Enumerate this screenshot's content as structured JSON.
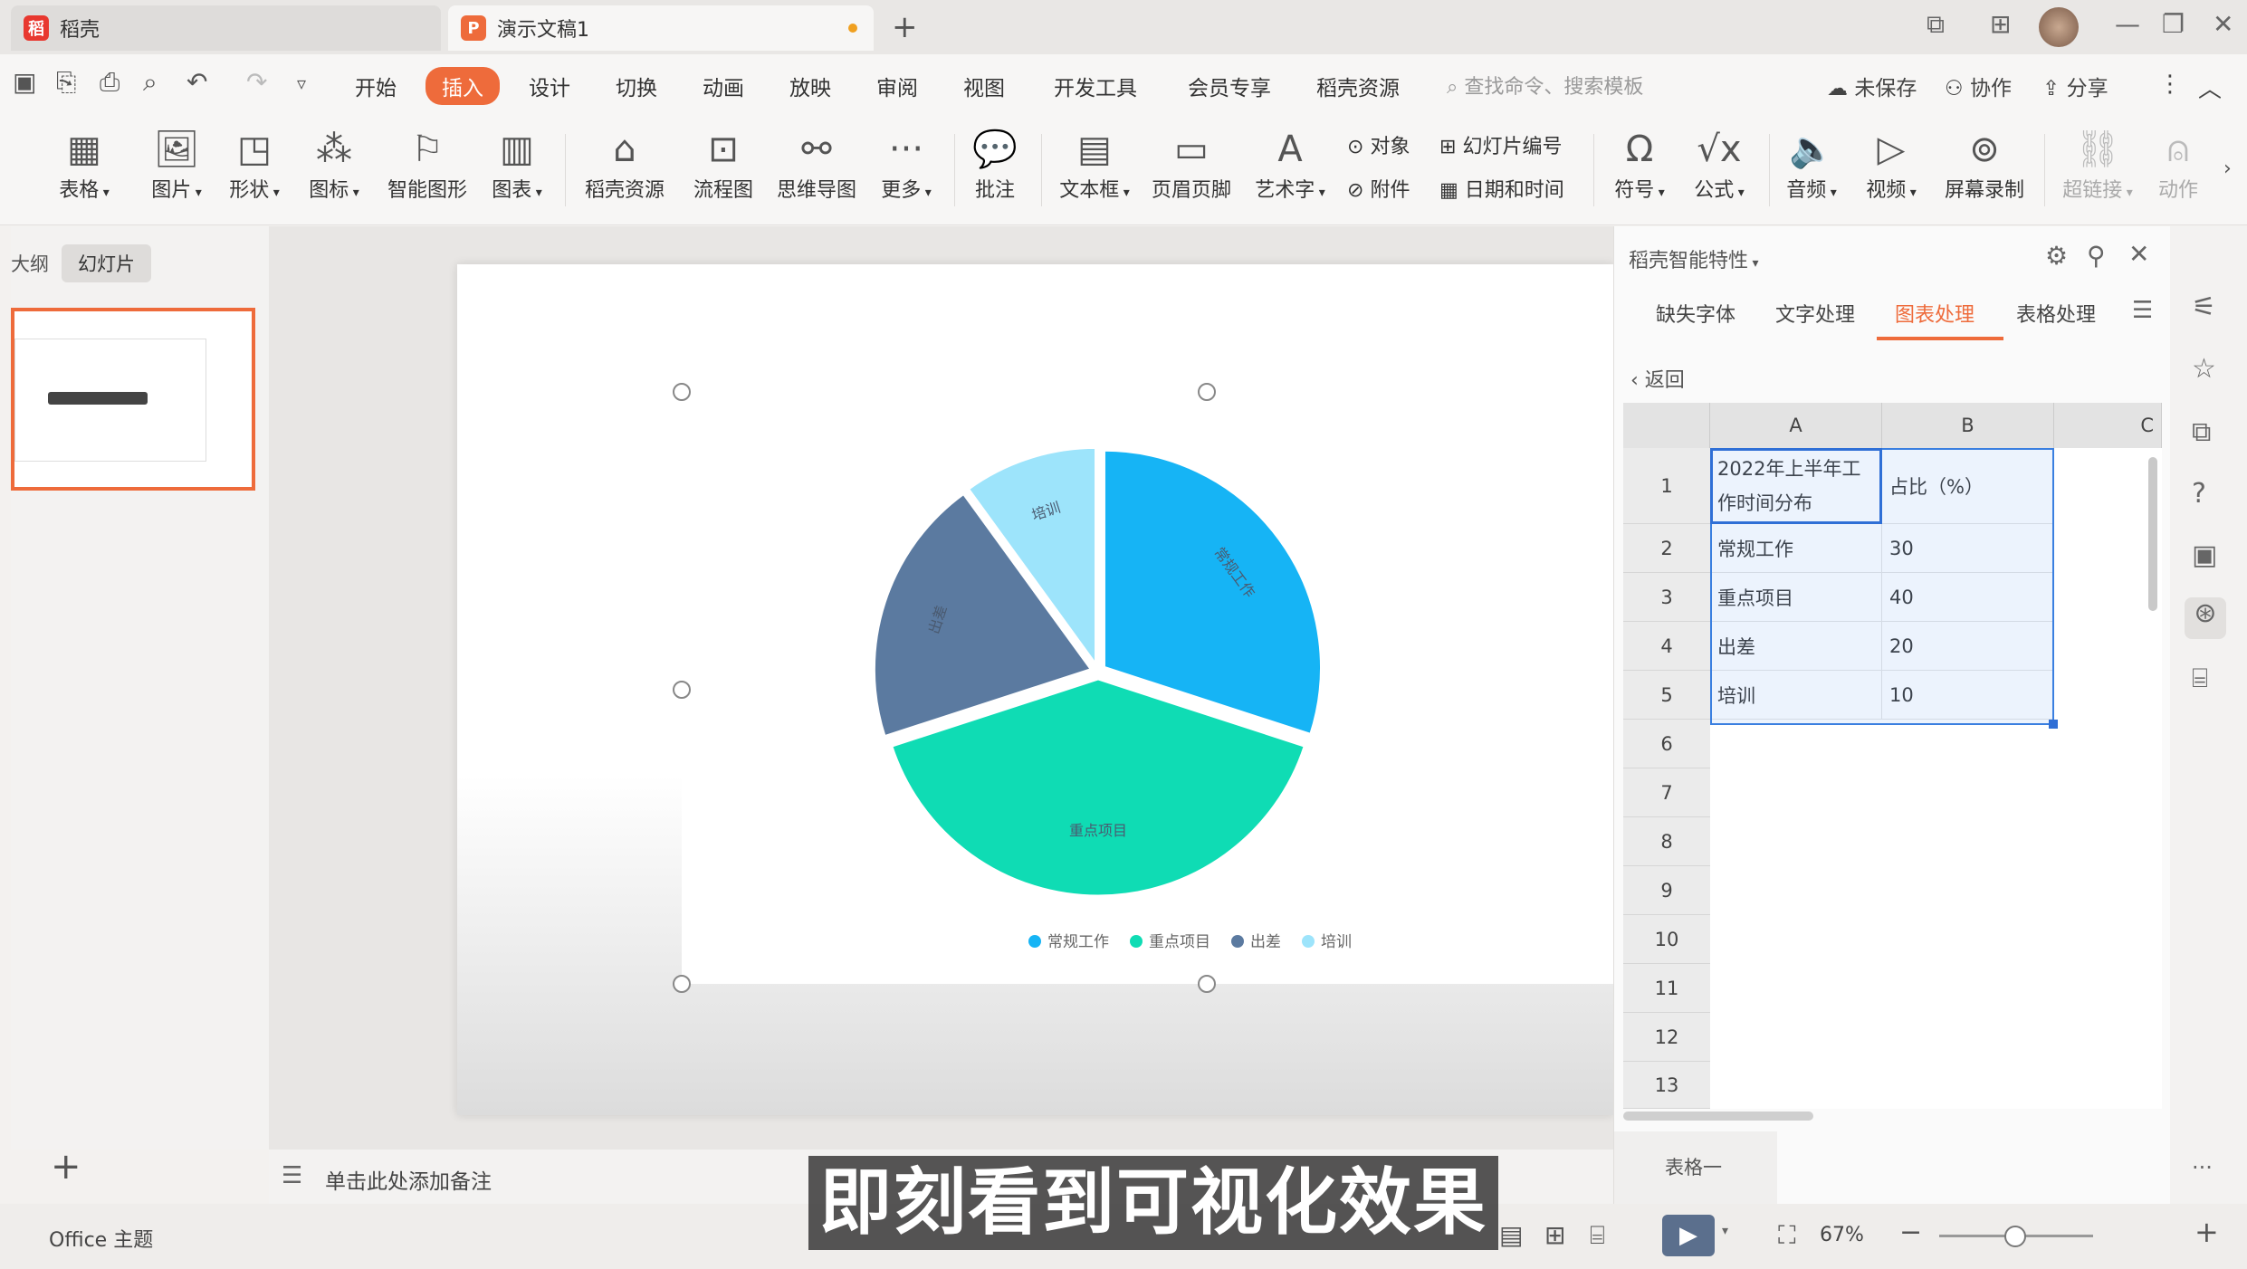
{
  "titlebar": {
    "home_tab": "稻壳",
    "doc_tab": "演示文稿1",
    "new_tab": "+"
  },
  "menu": {
    "items": [
      "开始",
      "插入",
      "设计",
      "切换",
      "动画",
      "放映",
      "审阅",
      "视图",
      "开发工具",
      "会员专享",
      "稻壳资源"
    ],
    "active": "插入",
    "search_placeholder": "查找命令、搜索模板",
    "unsaved": "未保存",
    "collab": "协作",
    "share": "分享"
  },
  "ribbon": {
    "buttons": [
      "表格",
      "图片",
      "形状",
      "图标",
      "智能图形",
      "图表",
      "稻壳资源",
      "流程图",
      "思维导图",
      "更多",
      "批注",
      "文本框",
      "页眉页脚",
      "艺术字"
    ],
    "small": [
      "对象",
      "幻灯片编号",
      "附件",
      "日期和时间"
    ],
    "buttons2": [
      "符号",
      "公式",
      "音频",
      "视频",
      "屏幕录制",
      "超链接",
      "动作"
    ]
  },
  "left_panel": {
    "tab_outline": "大纲",
    "tab_slides": "幻灯片"
  },
  "chart_data": {
    "type": "pie",
    "categories": [
      "常规工作",
      "重点项目",
      "出差",
      "培训"
    ],
    "values": [
      30,
      40,
      20,
      10
    ],
    "colors": [
      "#16b4f5",
      "#0fdcb4",
      "#5b7aa0",
      "#9de4fb"
    ],
    "title": "",
    "legend": "bottom"
  },
  "right_panel": {
    "header": "稻壳智能特性",
    "tabs": [
      "缺失字体",
      "文字处理",
      "图表处理",
      "表格处理"
    ],
    "active_tab": "图表处理",
    "back": "返回",
    "columns": [
      "A",
      "B",
      "C"
    ],
    "rows": [
      "1",
      "2",
      "3",
      "4",
      "5",
      "6",
      "7",
      "8",
      "9",
      "10",
      "11",
      "12",
      "13"
    ],
    "header_row": [
      "2022年上半年工作时间分布",
      "占比（%）"
    ],
    "data_rows": [
      [
        "常规工作",
        "30"
      ],
      [
        "重点项目",
        "40"
      ],
      [
        "出差",
        "20"
      ],
      [
        "培训",
        "10"
      ]
    ],
    "sheet_tab": "表格一"
  },
  "notes": {
    "placeholder": "单击此处添加备注",
    "add": "+"
  },
  "status": {
    "theme": "Office 主题",
    "zoom": "67%"
  },
  "subtitle": "即刻看到可视化效果"
}
